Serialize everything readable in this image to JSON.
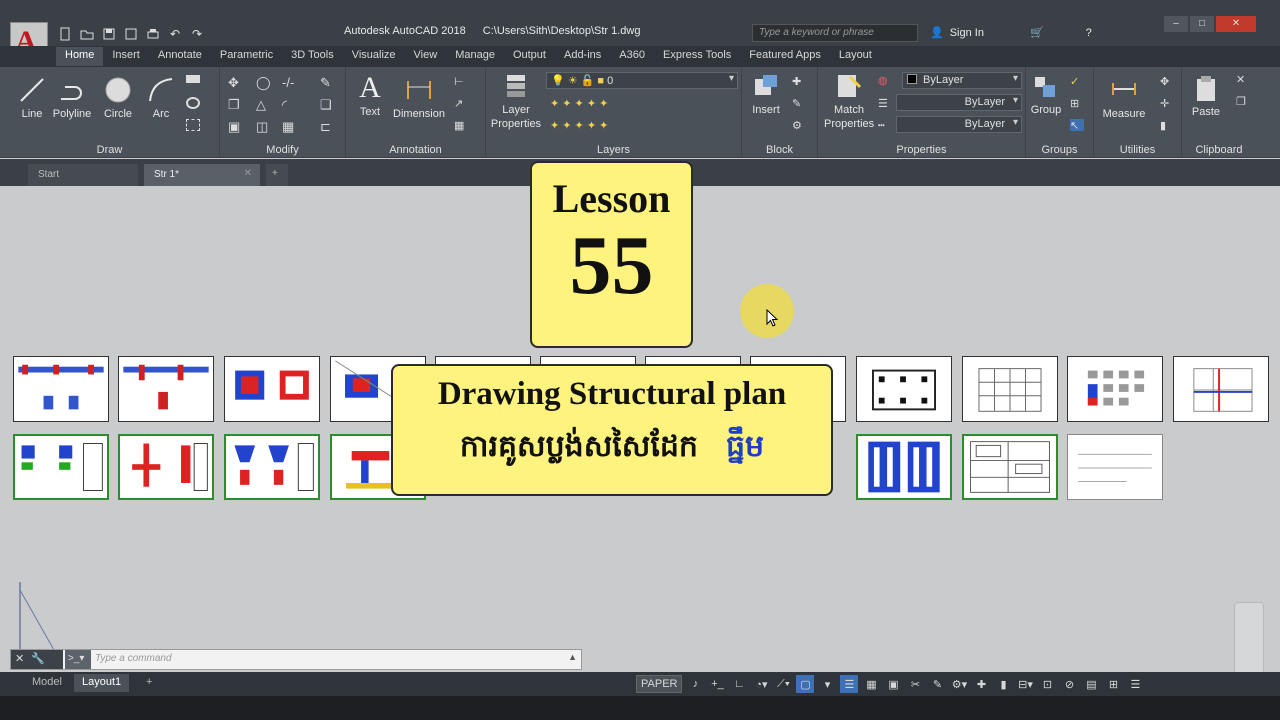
{
  "window": {
    "app_name": "Autodesk AutoCAD 2018",
    "file_path": "C:\\Users\\Sith\\Desktop\\Str 1.dwg",
    "search_placeholder": "Type a keyword or phrase",
    "sign_in": "Sign In"
  },
  "ribbon_tabs": [
    "Home",
    "Insert",
    "Annotate",
    "Parametric",
    "3D Tools",
    "Visualize",
    "View",
    "Manage",
    "Output",
    "Add-ins",
    "A360",
    "Express Tools",
    "Featured Apps",
    "Layout"
  ],
  "active_ribbon_tab": "Home",
  "draw": {
    "title": "Draw",
    "line": "Line",
    "polyline": "Polyline",
    "circle": "Circle",
    "arc": "Arc"
  },
  "modify": {
    "title": "Modify"
  },
  "annotation": {
    "title": "Annotation",
    "text": "Text",
    "dimension": "Dimension"
  },
  "layers": {
    "title": "Layers",
    "layer_properties_1": "Layer",
    "layer_properties_2": "Properties",
    "current_layer": "0"
  },
  "block": {
    "title": "Block",
    "insert": "Insert"
  },
  "properties": {
    "title": "Properties",
    "match_1": "Match",
    "match_2": "Properties",
    "color": "ByLayer",
    "linetype": "ByLayer",
    "lineweight": "ByLayer"
  },
  "groups": {
    "title": "Groups",
    "group": "Group"
  },
  "utilities": {
    "title": "Utilities",
    "measure": "Measure"
  },
  "clipboard": {
    "title": "Clipboard",
    "paste": "Paste"
  },
  "doc_tabs": {
    "start": "Start",
    "current": "Str 1*"
  },
  "overlay": {
    "lesson_label": "Lesson",
    "lesson_number": "55",
    "subtitle_en": "Drawing Structural plan",
    "subtitle_km": "ការគូសប្លង់សសៃដែក",
    "subtitle_km_highlight": "ធ្នឹម"
  },
  "command": {
    "placeholder": "Type a command"
  },
  "layout_tabs": {
    "model": "Model",
    "layout1": "Layout1",
    "add": "+"
  },
  "status": {
    "paper": "PAPER"
  },
  "colors": {
    "accent": "#3f6fb4",
    "ribbon": "#4b5159",
    "card": "#fef37e",
    "highlight": "#1f3fbf"
  }
}
